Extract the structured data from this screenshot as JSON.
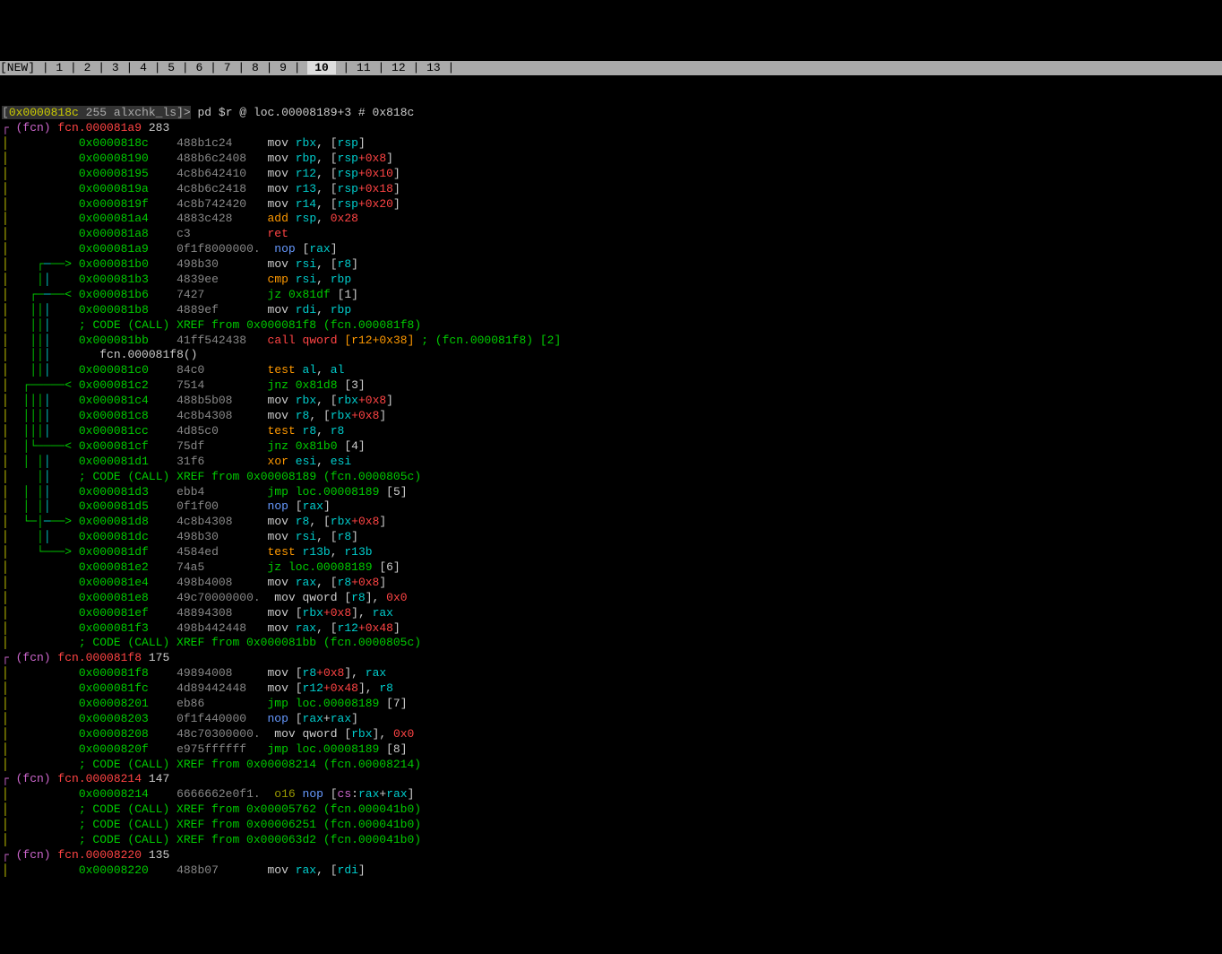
{
  "tabs": {
    "new": "[NEW]",
    "items": [
      "1",
      "2",
      "3",
      "4",
      "5",
      "6",
      "7",
      "8",
      "9",
      "10",
      "11",
      "12",
      "13"
    ],
    "active": "10"
  },
  "prompt": {
    "lbracket": "[",
    "addr": "0x0000818c",
    "sz": "255",
    "name": "alxchk_ls",
    "rbracket": "]>",
    "cmd": " pd $r @ loc.00008189+3 # 0x818c"
  },
  "l": {
    "f1": {
      "pre": "┌ (fcn) ",
      "name": "fcn.000081a9",
      "sz": " 283"
    },
    "r01": {
      "a": "0x0000818c",
      "h": "488b1c24",
      "op": "mov ",
      "r1": "rbx",
      "c": ", [",
      "r2": "rsp",
      "e": "]"
    },
    "r02": {
      "a": "0x00008190",
      "h": "488b6c2408",
      "op": "mov ",
      "r1": "rbp",
      "c": ", [",
      "r2": "rsp",
      "p": "+",
      "v": "0x8",
      "e": "]"
    },
    "r03": {
      "a": "0x00008195",
      "h": "4c8b642410",
      "op": "mov ",
      "r1": "r12",
      "c": ", [",
      "r2": "rsp",
      "p": "+",
      "v": "0x10",
      "e": "]"
    },
    "r04": {
      "a": "0x0000819a",
      "h": "4c8b6c2418",
      "op": "mov ",
      "r1": "r13",
      "c": ", [",
      "r2": "rsp",
      "p": "+",
      "v": "0x18",
      "e": "]"
    },
    "r05": {
      "a": "0x0000819f",
      "h": "4c8b742420",
      "op": "mov ",
      "r1": "r14",
      "c": ", [",
      "r2": "rsp",
      "p": "+",
      "v": "0x20",
      "e": "]"
    },
    "r06": {
      "a": "0x000081a4",
      "h": "4883c428",
      "op": "add ",
      "r1": "rsp",
      "c": ", ",
      "v": "0x28"
    },
    "r07": {
      "a": "0x000081a8",
      "h": "c3",
      "op": "ret"
    },
    "r08": {
      "a": "0x000081a9",
      "h": "0f1f8000000.",
      "op": "nop ",
      "b": "[",
      "r1": "rax",
      "e": "]"
    },
    "r09": {
      "a": "0x000081b0",
      "h": "498b30",
      "op": "mov ",
      "r1": "rsi",
      "c": ", [",
      "r2": "r8",
      "e": "]"
    },
    "r10": {
      "a": "0x000081b3",
      "h": "4839ee",
      "op": "cmp ",
      "r1": "rsi",
      "c": ", ",
      "r2": "rbp"
    },
    "r11": {
      "a": "0x000081b6",
      "h": "7427",
      "op": "jz 0x81df",
      "t": " [1]"
    },
    "r12": {
      "a": "0x000081b8",
      "h": "4889ef",
      "op": "mov ",
      "r1": "rdi",
      "c": ", ",
      "r2": "rbp"
    },
    "x1": {
      "t": "; CODE (CALL) XREF from 0x000081f8 (fcn.000081f8)"
    },
    "r13": {
      "a": "0x000081bb",
      "h": "41ff542438",
      "op": "call qword ",
      "b": "[",
      "r": "r12",
      "p": "+",
      "v": "0x38",
      "e": "]",
      "cm": " ; (",
      "fn": "fcn.000081f8",
      "cm2": ") [2]"
    },
    "fn1": {
      "t": "fcn.000081f8()"
    },
    "r14": {
      "a": "0x000081c0",
      "h": "84c0",
      "op": "test ",
      "r1": "al",
      "c": ", ",
      "r2": "al"
    },
    "r15": {
      "a": "0x000081c2",
      "h": "7514",
      "op": "jnz 0x81d8",
      "t": " [3]"
    },
    "r16": {
      "a": "0x000081c4",
      "h": "488b5b08",
      "op": "mov ",
      "r1": "rbx",
      "c": ", [",
      "r2": "rbx",
      "p": "+",
      "v": "0x8",
      "e": "]"
    },
    "r17": {
      "a": "0x000081c8",
      "h": "4c8b4308",
      "op": "mov ",
      "r1": "r8",
      "c": ", [",
      "r2": "rbx",
      "p": "+",
      "v": "0x8",
      "e": "]"
    },
    "r18": {
      "a": "0x000081cc",
      "h": "4d85c0",
      "op": "test ",
      "r1": "r8",
      "c": ", ",
      "r2": "r8"
    },
    "r19": {
      "a": "0x000081cf",
      "h": "75df",
      "op": "jnz 0x81b0",
      "t": " [4]"
    },
    "r20": {
      "a": "0x000081d1",
      "h": "31f6",
      "op": "xor ",
      "r1": "esi",
      "c": ", ",
      "r2": "esi"
    },
    "x2": {
      "t": "; CODE (CALL) XREF from 0x00008189 (fcn.0000805c)"
    },
    "r21": {
      "a": "0x000081d3",
      "h": "ebb4",
      "op": "jmp loc.00008189",
      "t": " [5]"
    },
    "r22": {
      "a": "0x000081d5",
      "h": "0f1f00",
      "op": "nop ",
      "b": "[",
      "r1": "rax",
      "e": "]"
    },
    "r23": {
      "a": "0x000081d8",
      "h": "4c8b4308",
      "op": "mov ",
      "r1": "r8",
      "c": ", [",
      "r2": "rbx",
      "p": "+",
      "v": "0x8",
      "e": "]"
    },
    "r24": {
      "a": "0x000081dc",
      "h": "498b30",
      "op": "mov ",
      "r1": "rsi",
      "c": ", [",
      "r2": "r8",
      "e": "]"
    },
    "r25": {
      "a": "0x000081df",
      "h": "4584ed",
      "op": "test ",
      "r1": "r13b",
      "c": ", ",
      "r2": "r13b"
    },
    "r26": {
      "a": "0x000081e2",
      "h": "74a5",
      "op": "jz loc.00008189",
      "t": " [6]"
    },
    "r27": {
      "a": "0x000081e4",
      "h": "498b4008",
      "op": "mov ",
      "r1": "rax",
      "c": ", [",
      "r2": "r8",
      "p": "+",
      "v": "0x8",
      "e": "]"
    },
    "r28": {
      "a": "0x000081e8",
      "h": "49c70000000.",
      "op": "mov qword ",
      "b": "[",
      "r": "r8",
      "e": "]",
      "c": ", ",
      "v": "0x0"
    },
    "r29": {
      "a": "0x000081ef",
      "h": "48894308",
      "op": "mov ",
      "b": "[",
      "r": "rbx",
      "p": "+",
      "v": "0x8",
      "e": "]",
      "c": ", ",
      "r2": "rax"
    },
    "r30": {
      "a": "0x000081f3",
      "h": "498b442448",
      "op": "mov ",
      "r1": "rax",
      "c": ", [",
      "r2": "r12",
      "p": "+",
      "v": "0x48",
      "e": "]"
    },
    "x3": {
      "t": "; CODE (CALL) XREF from 0x000081bb (fcn.0000805c)"
    },
    "f2": {
      "pre": "┌ (fcn) ",
      "name": "fcn.000081f8",
      "sz": " 175"
    },
    "r31": {
      "a": "0x000081f8",
      "h": "49894008",
      "op": "mov ",
      "b": "[",
      "r": "r8",
      "p": "+",
      "v": "0x8",
      "e": "]",
      "c": ", ",
      "r2": "rax"
    },
    "r32": {
      "a": "0x000081fc",
      "h": "4d89442448",
      "op": "mov ",
      "b": "[",
      "r": "r12",
      "p": "+",
      "v": "0x48",
      "e": "]",
      "c": ", ",
      "r2": "r8"
    },
    "r33": {
      "a": "0x00008201",
      "h": "eb86",
      "op": "jmp loc.00008189",
      "t": " [7]"
    },
    "r34": {
      "a": "0x00008203",
      "h": "0f1f440000",
      "op": "nop ",
      "b": "[",
      "r1": "rax",
      "p": "+",
      "r2": "rax",
      "e": "]"
    },
    "r35": {
      "a": "0x00008208",
      "h": "48c70300000.",
      "op": "mov qword ",
      "b": "[",
      "r": "rbx",
      "e": "]",
      "c": ", ",
      "v": "0x0"
    },
    "r36": {
      "a": "0x0000820f",
      "h": "e975ffffff",
      "op": "jmp loc.00008189",
      "t": " [8]"
    },
    "x4": {
      "t": "; CODE (CALL) XREF from 0x00008214 (fcn.00008214)"
    },
    "f3": {
      "pre": "┌ (fcn) ",
      "name": "fcn.00008214",
      "sz": " 147"
    },
    "r37": {
      "a": "0x00008214",
      "h": "6666662e0f1.",
      "pfx": "o16 ",
      "op": "nop ",
      "b": "[",
      "seg": "cs",
      "co": ":",
      "r1": "rax",
      "p": "+",
      "r2": "rax",
      "e": "]"
    },
    "x5": {
      "t": "; CODE (CALL) XREF from 0x00005762 (fcn.000041b0)"
    },
    "x6": {
      "t": "; CODE (CALL) XREF from 0x00006251 (fcn.000041b0)"
    },
    "x7": {
      "t": "; CODE (CALL) XREF from 0x000063d2 (fcn.000041b0)"
    },
    "f4": {
      "pre": "┌ (fcn) ",
      "name": "fcn.00008220",
      "sz": " 135"
    },
    "r38": {
      "a": "0x00008220",
      "h": "488b07",
      "op": "mov ",
      "r1": "rax",
      "c": ", [",
      "r2": "rdi",
      "e": "]"
    }
  }
}
